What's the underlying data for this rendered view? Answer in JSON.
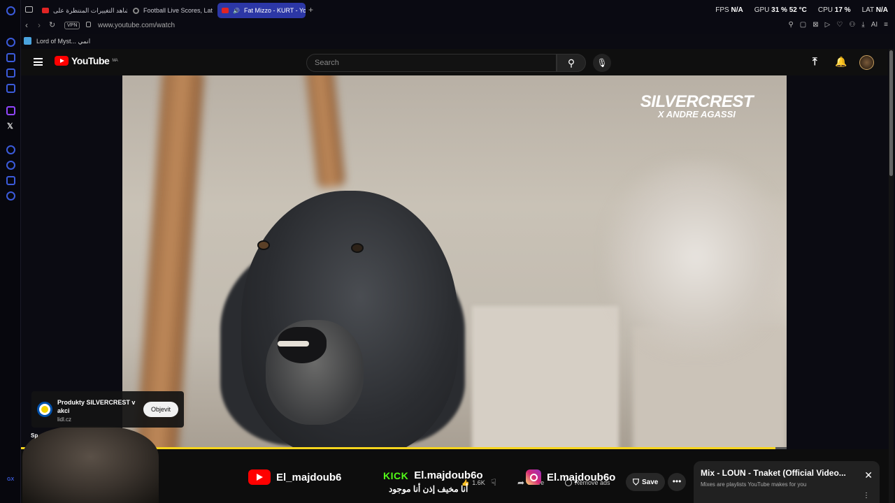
{
  "browser": {
    "tabs": [
      {
        "label": "شاهد التغييرات المنتظرة على"
      },
      {
        "label": "Football Live Scores, Late"
      },
      {
        "label": "Fat Mizzo - KURT - Yo"
      }
    ],
    "new_tab": "+",
    "url": "www.youtube.com/watch",
    "vpn": "VPN",
    "bookmark": "Lord of Myst... انمي",
    "hud": {
      "fps_label": "FPS",
      "fps_value": "N/A",
      "gpu_label": "GPU",
      "gpu_value": "31 % 52 °C",
      "cpu_label": "CPU",
      "cpu_value": "17 %",
      "lat_label": "LAT",
      "lat_value": "N/A"
    },
    "gx_label": "GX"
  },
  "youtube": {
    "logo": "YouTube",
    "region": "MA",
    "search_placeholder": "Search",
    "ad": {
      "title": "Produkty SILVERCREST v akci",
      "url": "lidl.cz",
      "button": "Objevit"
    },
    "video_overlay": {
      "brand": "SILVERCREST",
      "collab": "X ANDRE AGASSI"
    },
    "sponsor_label": "Sp",
    "socials": [
      {
        "network": "youtube",
        "handle": "El_majdoub6"
      },
      {
        "network": "kick",
        "badge": "KICK",
        "handle": "El.majdoub6o"
      },
      {
        "network": "instagram",
        "handle": "El.majdoub6o"
      }
    ],
    "caption_arabic": "أنا مخيف إذن أنا موجود",
    "actions": {
      "like": "1.6K",
      "share": "Share",
      "remove_ads": "Remove ads",
      "save": "Save"
    },
    "mix": {
      "title": "Mix - LOUN - Tnaket (Official Video...",
      "subtitle": "Mixes are playlists YouTube makes for you"
    },
    "playback_progress": 0.985
  }
}
